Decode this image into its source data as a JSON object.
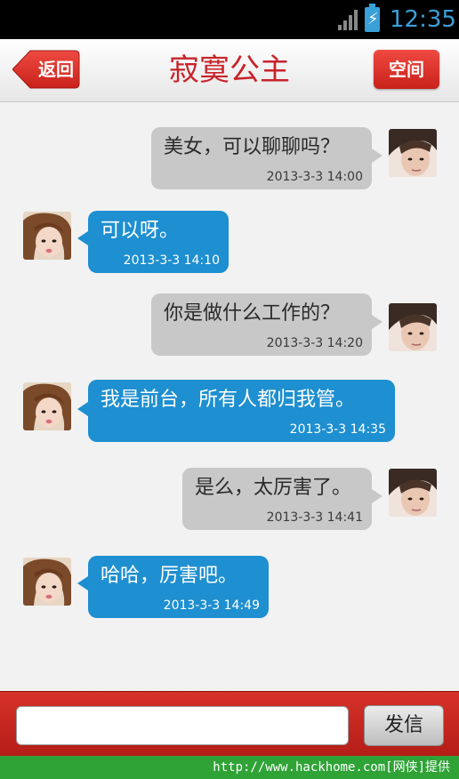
{
  "status_bar": {
    "time": "12:35"
  },
  "header": {
    "back_label": "返回",
    "title": "寂寞公主",
    "space_label": "空间"
  },
  "messages": [
    {
      "sender": "me",
      "text": "美女，可以聊聊吗？",
      "time": "2013-3-3 14:00"
    },
    {
      "sender": "her",
      "text": "可以呀。",
      "time": "2013-3-3 14:10"
    },
    {
      "sender": "me",
      "text": "你是做什么工作的？",
      "time": "2013-3-3 14:20"
    },
    {
      "sender": "her",
      "text": "我是前台，所有人都归我管。",
      "time": "2013-3-3 14:35"
    },
    {
      "sender": "me",
      "text": "是么，太厉害了。",
      "time": "2013-3-3 14:41"
    },
    {
      "sender": "her",
      "text": "哈哈，厉害吧。",
      "time": "2013-3-3 14:49"
    }
  ],
  "composer": {
    "input_value": "",
    "send_label": "发信"
  },
  "footer": {
    "watermark": "http://www.hackhome.com[网侠]提供"
  },
  "colors": {
    "accent_red": "#c8242a",
    "bubble_in": "#1e8fd0",
    "bubble_out": "#c8c8c8",
    "footer_green": "#2fa336"
  }
}
